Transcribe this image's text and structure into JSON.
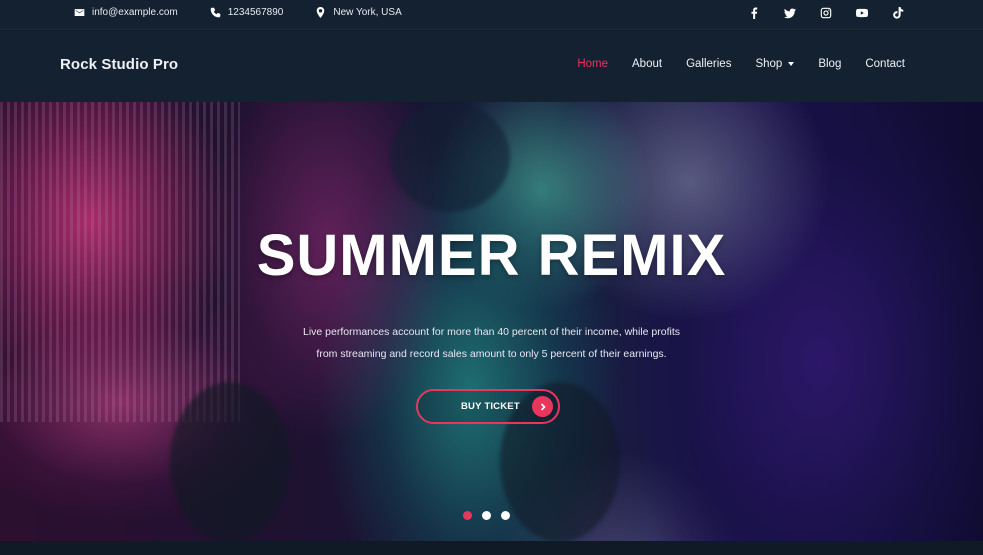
{
  "topbar": {
    "email": "info@example.com",
    "phone": "1234567890",
    "location": "New York, USA",
    "social": [
      {
        "name": "facebook-icon"
      },
      {
        "name": "twitter-icon"
      },
      {
        "name": "instagram-icon"
      },
      {
        "name": "youtube-icon"
      },
      {
        "name": "tiktok-icon"
      }
    ]
  },
  "navbar": {
    "brand": "Rock Studio Pro",
    "items": [
      {
        "label": "Home",
        "active": true
      },
      {
        "label": "About"
      },
      {
        "label": "Galleries"
      },
      {
        "label": "Shop",
        "dropdown": true
      },
      {
        "label": "Blog"
      },
      {
        "label": "Contact"
      }
    ]
  },
  "hero": {
    "title": "SUMMER REMIX",
    "subtitle_line1": "Live performances account for more than 40 percent of their income, while profits",
    "subtitle_line2": "from streaming and record sales amount to only 5 percent of their earnings.",
    "cta_label": "BUY TICKET",
    "slides": 3,
    "active_slide": 1
  },
  "colors": {
    "accent": "#e8365d",
    "header_bg": "#142131",
    "text": "#ffffff"
  }
}
